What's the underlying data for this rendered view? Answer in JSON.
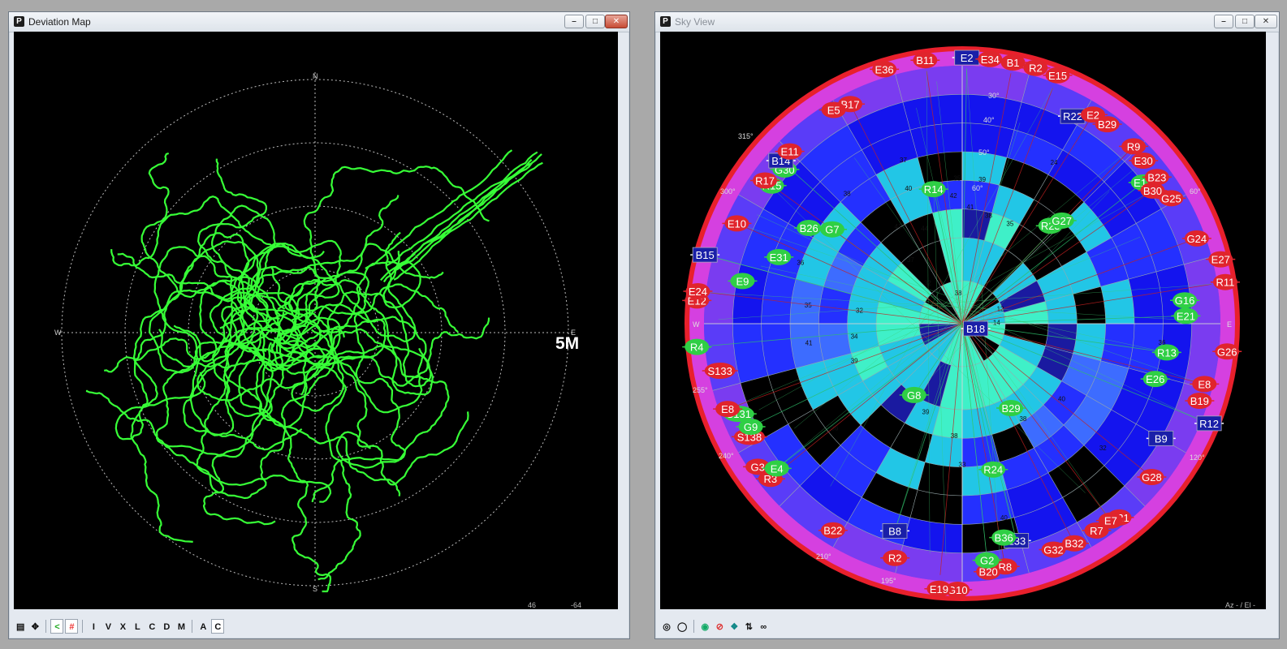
{
  "deviation": {
    "title": "Deviation Map",
    "app_icon": "P",
    "cardinal": {
      "n": "N",
      "s": "S",
      "e": "E",
      "w": "W"
    },
    "scale_label": "5M",
    "readout_a": "46",
    "readout_b": "-64",
    "toolbar": [
      {
        "icon": "settings-panel-icon"
      },
      {
        "icon": "pan-arrows-icon"
      },
      {
        "icon": "track-icon"
      },
      {
        "icon": "grid-hash-icon"
      },
      {
        "label": "I"
      },
      {
        "label": "V"
      },
      {
        "label": "X"
      },
      {
        "label": "L"
      },
      {
        "label": "C"
      },
      {
        "label": "D"
      },
      {
        "label": "M"
      },
      {
        "label": "A"
      },
      {
        "label": "C"
      }
    ],
    "colors": {
      "trace": "#37ff37",
      "ring": "#bcbcbc"
    }
  },
  "sky": {
    "title": "Sky View",
    "app_icon": "P",
    "readout": "Az - / El -",
    "az_labels": {
      "n": "N",
      "w": "W",
      "e": "E",
      "a315": "315°",
      "a300": "300°",
      "a60": "60°",
      "a120": "120°",
      "a240": "240°",
      "a210": "210°",
      "a195": "195°",
      "a255": "255°"
    },
    "el_labels": [
      "30°",
      "40°",
      "50°",
      "60°"
    ],
    "cells": [
      {
        "v": "38",
        "el": 80,
        "az": 352
      },
      {
        "v": "32",
        "el": 72,
        "az": 318
      },
      {
        "v": "37",
        "el": 62,
        "az": 320
      },
      {
        "v": "44",
        "el": 55,
        "az": 338
      },
      {
        "v": "41",
        "el": 50,
        "az": 326
      },
      {
        "v": "42",
        "el": 46,
        "az": 356
      },
      {
        "v": "41",
        "el": 50,
        "az": 4
      },
      {
        "v": "38",
        "el": 52,
        "az": 14
      },
      {
        "v": "35",
        "el": 52,
        "az": 26
      },
      {
        "v": "40",
        "el": 40,
        "az": 338
      },
      {
        "v": "35",
        "el": 40,
        "az": 358
      },
      {
        "v": "39",
        "el": 40,
        "az": 8
      },
      {
        "v": "38",
        "el": 30,
        "az": 318
      },
      {
        "v": "37",
        "el": 30,
        "az": 340
      },
      {
        "v": "24",
        "el": 26,
        "az": 30
      },
      {
        "v": "36",
        "el": 30,
        "az": 290
      },
      {
        "v": "35",
        "el": 36,
        "az": 276
      },
      {
        "v": "32",
        "el": 54,
        "az": 276
      },
      {
        "v": "34",
        "el": 52,
        "az": 262
      },
      {
        "v": "41",
        "el": 36,
        "az": 262
      },
      {
        "v": "39",
        "el": 50,
        "az": 250
      },
      {
        "v": "36",
        "el": 32,
        "az": 230
      },
      {
        "v": "40",
        "el": 20,
        "az": 168
      },
      {
        "v": "32",
        "el": 24,
        "az": 132
      },
      {
        "v": "36",
        "el": 20,
        "az": 96
      },
      {
        "v": "40",
        "el": 46,
        "az": 128
      },
      {
        "v": "38",
        "el": 50,
        "az": 148
      },
      {
        "v": "33",
        "el": 40,
        "az": 180
      },
      {
        "v": "38",
        "el": 50,
        "az": 184
      },
      {
        "v": "39",
        "el": 56,
        "az": 202
      },
      {
        "v": "14",
        "el": 78,
        "az": 92
      },
      {
        "v": "12",
        "el": 76,
        "az": 72
      }
    ],
    "sats": [
      {
        "id": "E2",
        "c": "blue",
        "az": 1,
        "el": 1
      },
      {
        "id": "E34",
        "c": "red",
        "az": 6,
        "el": 1
      },
      {
        "id": "B1",
        "c": "red",
        "az": 11,
        "el": 1
      },
      {
        "id": "R2",
        "c": "red",
        "az": 16,
        "el": 2
      },
      {
        "id": "E15",
        "c": "red",
        "az": 21,
        "el": 2
      },
      {
        "id": "R22",
        "c": "blue",
        "az": 28,
        "el": 8
      },
      {
        "id": "E2",
        "c": "red",
        "az": 32,
        "el": 4
      },
      {
        "id": "B29",
        "c": "red",
        "az": 36,
        "el": 4
      },
      {
        "id": "B11",
        "c": "red",
        "az": 352,
        "el": 1
      },
      {
        "id": "E36",
        "c": "red",
        "az": 343,
        "el": 1
      },
      {
        "id": "B17",
        "c": "red",
        "az": 333,
        "el": 4
      },
      {
        "id": "E5",
        "c": "red",
        "az": 329,
        "el": 3
      },
      {
        "id": "R9",
        "c": "red",
        "az": 44,
        "el": 4
      },
      {
        "id": "E30",
        "c": "red",
        "az": 48,
        "el": 5
      },
      {
        "id": "E13",
        "c": "green",
        "az": 52,
        "el": 10
      },
      {
        "id": "B23",
        "c": "red",
        "az": 53,
        "el": 5
      },
      {
        "id": "B30",
        "c": "red",
        "az": 55,
        "el": 9
      },
      {
        "id": "G25",
        "c": "red",
        "az": 59,
        "el": 5
      },
      {
        "id": "G24",
        "c": "red",
        "az": 70,
        "el": 3
      },
      {
        "id": "E27",
        "c": "red",
        "az": 76,
        "el": 1
      },
      {
        "id": "R11",
        "c": "red",
        "az": 81,
        "el": 2
      },
      {
        "id": "G16",
        "c": "green",
        "az": 84,
        "el": 12
      },
      {
        "id": "E21",
        "c": "green",
        "az": 88,
        "el": 12
      },
      {
        "id": "G26",
        "c": "red",
        "az": 96,
        "el": 2
      },
      {
        "id": "R13",
        "c": "green",
        "az": 98,
        "el": 18
      },
      {
        "id": "E26",
        "c": "green",
        "az": 106,
        "el": 20
      },
      {
        "id": "E8",
        "c": "red",
        "az": 104,
        "el": 3
      },
      {
        "id": "B19",
        "c": "red",
        "az": 108,
        "el": 3
      },
      {
        "id": "R12",
        "c": "blue",
        "az": 112,
        "el": 2
      },
      {
        "id": "B9",
        "c": "blue",
        "az": 120,
        "el": 10
      },
      {
        "id": "G28",
        "c": "red",
        "az": 129,
        "el": 5
      },
      {
        "id": "G21",
        "c": "red",
        "az": 141,
        "el": 3
      },
      {
        "id": "E7",
        "c": "red",
        "az": 143,
        "el": 4
      },
      {
        "id": "R7",
        "c": "red",
        "az": 147,
        "el": 4
      },
      {
        "id": "B32",
        "c": "red",
        "az": 153,
        "el": 4
      },
      {
        "id": "G32",
        "c": "red",
        "az": 158,
        "el": 5
      },
      {
        "id": "E33",
        "c": "blue",
        "az": 166,
        "el": 12
      },
      {
        "id": "B36",
        "c": "green",
        "az": 169,
        "el": 14
      },
      {
        "id": "R8",
        "c": "red",
        "az": 170,
        "el": 4
      },
      {
        "id": "B20",
        "c": "red",
        "az": 174,
        "el": 3
      },
      {
        "id": "G2",
        "c": "green",
        "az": 174,
        "el": 7
      },
      {
        "id": "G10",
        "c": "red",
        "az": 181,
        "el": 2
      },
      {
        "id": "E19",
        "c": "red",
        "az": 185,
        "el": 2
      },
      {
        "id": "R2",
        "c": "red",
        "az": 196,
        "el": 5
      },
      {
        "id": "B8",
        "c": "blue",
        "az": 198,
        "el": 14
      },
      {
        "id": "B22",
        "c": "red",
        "az": 212,
        "el": 5
      },
      {
        "id": "R3",
        "c": "red",
        "az": 231,
        "el": 4
      },
      {
        "id": "G3",
        "c": "red",
        "az": 235,
        "el": 3
      },
      {
        "id": "E4",
        "c": "green",
        "az": 232,
        "el": 8
      },
      {
        "id": "S138",
        "c": "red",
        "az": 242,
        "el": 6
      },
      {
        "id": "G9",
        "c": "green",
        "az": 244,
        "el": 8
      },
      {
        "id": "S131",
        "c": "green",
        "az": 248,
        "el": 6
      },
      {
        "id": "E8",
        "c": "red",
        "az": 250,
        "el": 3
      },
      {
        "id": "S133",
        "c": "red",
        "az": 259,
        "el": 4
      },
      {
        "id": "R4",
        "c": "green",
        "az": 265,
        "el": 2
      },
      {
        "id": "E12",
        "c": "red",
        "az": 275,
        "el": 1
      },
      {
        "id": "E24",
        "c": "red",
        "az": 277,
        "el": 1
      },
      {
        "id": "E9",
        "c": "green",
        "az": 281,
        "el": 12
      },
      {
        "id": "B15",
        "c": "blue",
        "az": 285,
        "el": 1
      },
      {
        "id": "E31",
        "c": "green",
        "az": 290,
        "el": 22
      },
      {
        "id": "E10",
        "c": "red",
        "az": 294,
        "el": 4
      },
      {
        "id": "B26",
        "c": "green",
        "az": 302,
        "el": 27
      },
      {
        "id": "G7",
        "c": "green",
        "az": 306,
        "el": 34
      },
      {
        "id": "R15",
        "c": "green",
        "az": 306,
        "el": 8
      },
      {
        "id": "R17",
        "c": "red",
        "az": 306,
        "el": 5
      },
      {
        "id": "G30",
        "c": "green",
        "az": 311,
        "el": 8
      },
      {
        "id": "B14",
        "c": "blue",
        "az": 312,
        "el": 5
      },
      {
        "id": "E11",
        "c": "red",
        "az": 315,
        "el": 5
      },
      {
        "id": "R14",
        "c": "green",
        "az": 348,
        "el": 42
      },
      {
        "id": "R23",
        "c": "green",
        "az": 42,
        "el": 44
      },
      {
        "id": "G27",
        "c": "green",
        "az": 44,
        "el": 40
      },
      {
        "id": "B18",
        "c": "blue",
        "az": 110,
        "el": 85
      },
      {
        "id": "G8",
        "c": "green",
        "az": 214,
        "el": 60
      },
      {
        "id": "B29",
        "c": "green",
        "az": 150,
        "el": 56
      },
      {
        "id": "R24",
        "c": "green",
        "az": 168,
        "el": 38
      }
    ],
    "toolbar": [
      {
        "icon": "target-icon"
      },
      {
        "icon": "ring-icon"
      },
      {
        "icon": "globe-icon"
      },
      {
        "icon": "no-entry-icon"
      },
      {
        "icon": "satellite-icon"
      },
      {
        "icon": "sort-icon"
      },
      {
        "icon": "scale-icon"
      }
    ],
    "colors": {
      "red": "#e0242c",
      "green": "#2fcf45",
      "blue": "#1a1fa8"
    }
  }
}
